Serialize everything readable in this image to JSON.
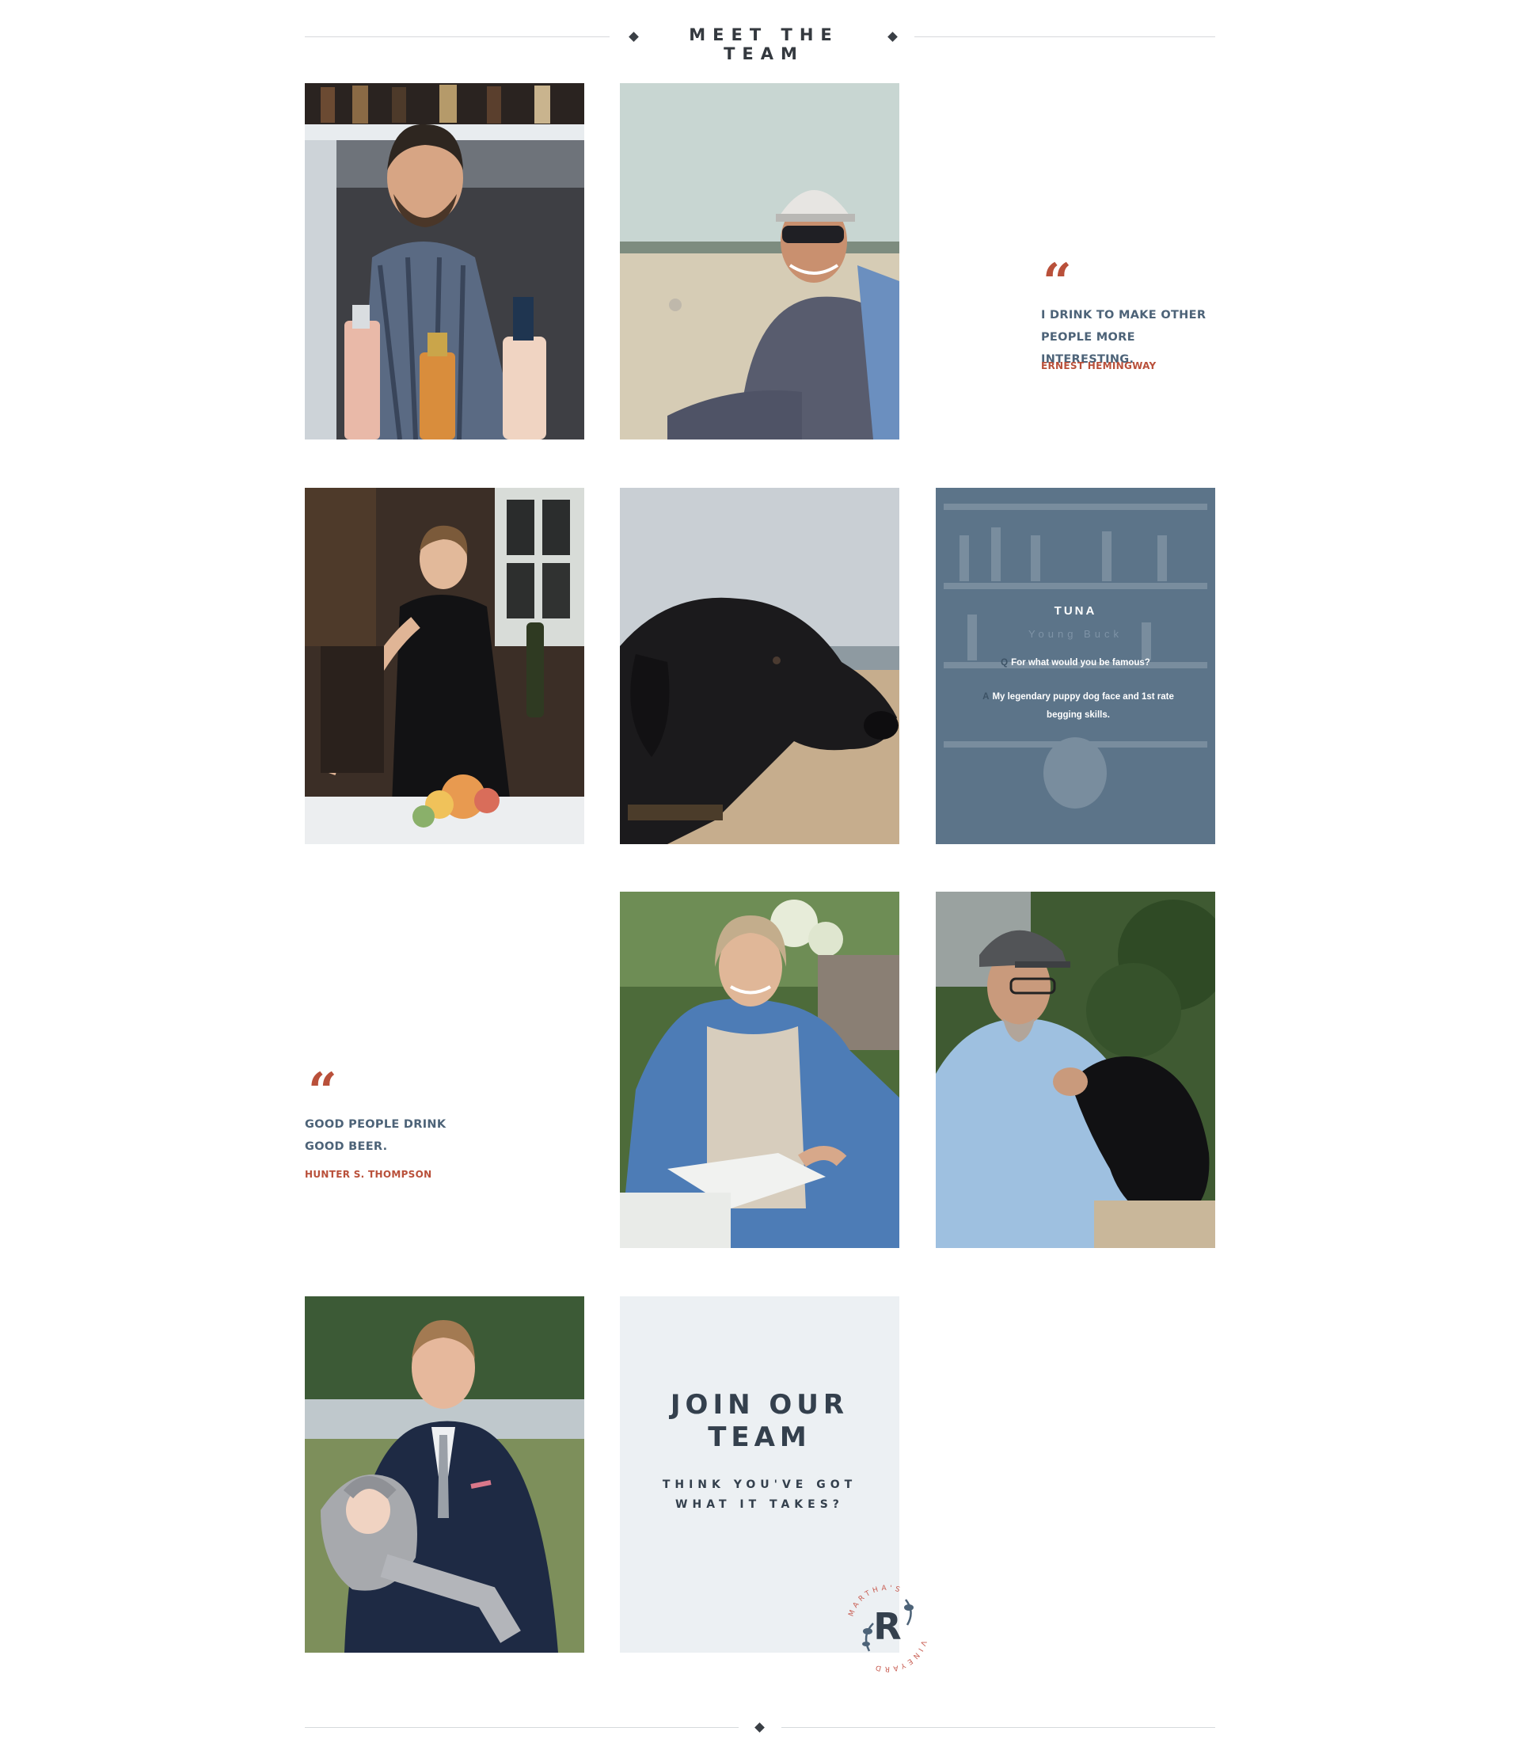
{
  "section": {
    "title": "MEET THE TEAM"
  },
  "quotes": [
    {
      "text": "I DRINK TO MAKE OTHER PEOPLE MORE INTERESTING.",
      "author": "ERNEST HEMINGWAY"
    },
    {
      "text": "GOOD PEOPLE DRINK GOOD BEER.",
      "author": "HUNTER S. THOMPSON"
    }
  ],
  "quote_mark": "“",
  "member_card": {
    "name": "TUNA",
    "role": "Young Buck",
    "q_letter": "Q",
    "question": "For what would you be famous?",
    "a_letter": "A",
    "answer": "My legendary puppy dog face and 1st rate begging skills."
  },
  "join": {
    "title": "JOIN OUR TEAM",
    "subtitle": "THINK YOU'VE GOT WHAT IT TAKES?"
  },
  "logo": {
    "letter": "R",
    "ring_text_top": "MARTHA'S",
    "ring_text_bottom": "VINEYARD"
  },
  "colors": {
    "accent": "#b9503a",
    "heading": "#34393f",
    "quote_text": "#4d6378",
    "card_bg": "#5c7489",
    "join_bg": "#ecf0f3"
  }
}
